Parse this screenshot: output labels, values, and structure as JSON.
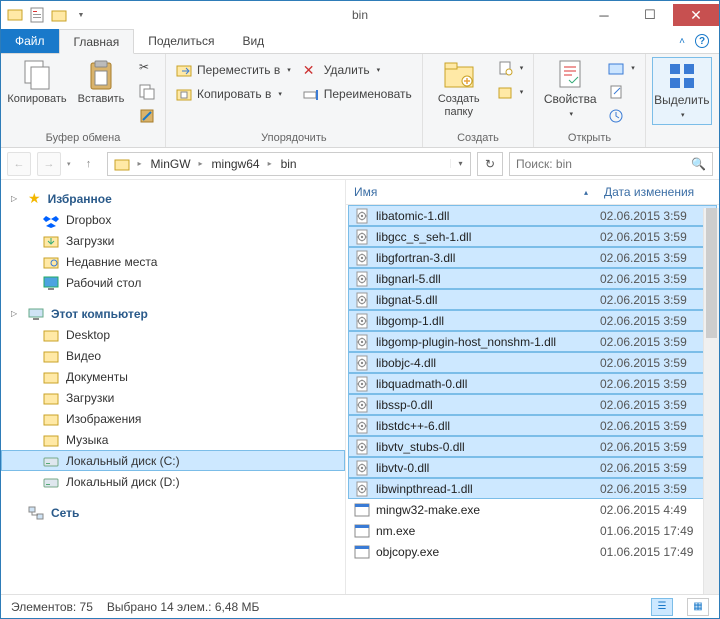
{
  "window": {
    "title": "bin"
  },
  "tabs": {
    "file": "Файл",
    "home": "Главная",
    "share": "Поделиться",
    "view": "Вид"
  },
  "ribbon": {
    "clipboard": {
      "copy": "Копировать",
      "paste": "Вставить",
      "label": "Буфер обмена"
    },
    "organize": {
      "move": "Переместить в",
      "copyTo": "Копировать в",
      "delete": "Удалить",
      "rename": "Переименовать",
      "label": "Упорядочить"
    },
    "new": {
      "folder": "Создать\nпапку",
      "label": "Создать"
    },
    "open": {
      "props": "Свойства",
      "label": "Открыть"
    },
    "select": {
      "select": "Выделить",
      "label": ""
    }
  },
  "breadcrumb": [
    "MinGW",
    "mingw64",
    "bin"
  ],
  "search": {
    "placeholder": "Поиск: bin"
  },
  "nav": {
    "favorites": "Избранное",
    "fav_items": [
      "Dropbox",
      "Загрузки",
      "Недавние места",
      "Рабочий стол"
    ],
    "computer": "Этот компьютер",
    "comp_items": [
      "Desktop",
      "Видео",
      "Документы",
      "Загрузки",
      "Изображения",
      "Музыка",
      "Локальный диск (C:)",
      "Локальный диск (D:)"
    ],
    "network": "Сеть"
  },
  "columns": {
    "name": "Имя",
    "date": "Дата изменения"
  },
  "files": [
    {
      "name": "libatomic-1.dll",
      "date": "02.06.2015 3:59",
      "sel": true,
      "type": "dll"
    },
    {
      "name": "libgcc_s_seh-1.dll",
      "date": "02.06.2015 3:59",
      "sel": true,
      "type": "dll"
    },
    {
      "name": "libgfortran-3.dll",
      "date": "02.06.2015 3:59",
      "sel": true,
      "type": "dll"
    },
    {
      "name": "libgnarl-5.dll",
      "date": "02.06.2015 3:59",
      "sel": true,
      "type": "dll"
    },
    {
      "name": "libgnat-5.dll",
      "date": "02.06.2015 3:59",
      "sel": true,
      "type": "dll"
    },
    {
      "name": "libgomp-1.dll",
      "date": "02.06.2015 3:59",
      "sel": true,
      "type": "dll"
    },
    {
      "name": "libgomp-plugin-host_nonshm-1.dll",
      "date": "02.06.2015 3:59",
      "sel": true,
      "type": "dll"
    },
    {
      "name": "libobjc-4.dll",
      "date": "02.06.2015 3:59",
      "sel": true,
      "type": "dll"
    },
    {
      "name": "libquadmath-0.dll",
      "date": "02.06.2015 3:59",
      "sel": true,
      "type": "dll"
    },
    {
      "name": "libssp-0.dll",
      "date": "02.06.2015 3:59",
      "sel": true,
      "type": "dll"
    },
    {
      "name": "libstdc++-6.dll",
      "date": "02.06.2015 3:59",
      "sel": true,
      "type": "dll"
    },
    {
      "name": "libvtv_stubs-0.dll",
      "date": "02.06.2015 3:59",
      "sel": true,
      "type": "dll"
    },
    {
      "name": "libvtv-0.dll",
      "date": "02.06.2015 3:59",
      "sel": true,
      "type": "dll"
    },
    {
      "name": "libwinpthread-1.dll",
      "date": "02.06.2015 3:59",
      "sel": true,
      "type": "dll"
    },
    {
      "name": "mingw32-make.exe",
      "date": "02.06.2015 4:49",
      "sel": false,
      "type": "exe"
    },
    {
      "name": "nm.exe",
      "date": "01.06.2015 17:49",
      "sel": false,
      "type": "exe"
    },
    {
      "name": "objcopy.exe",
      "date": "01.06.2015 17:49",
      "sel": false,
      "type": "exe"
    }
  ],
  "status": {
    "count": "Элементов: 75",
    "selected": "Выбрано 14 элем.: 6,48 МБ"
  }
}
